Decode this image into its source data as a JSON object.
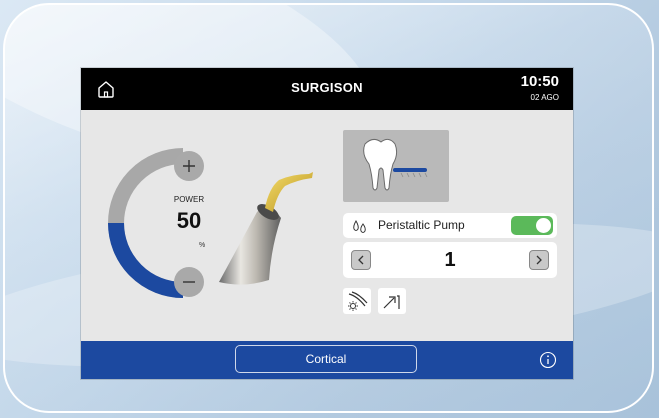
{
  "header": {
    "title": "SURGISON",
    "time": "10:50",
    "date": "02 AGO"
  },
  "power": {
    "label": "POWER",
    "value": "50",
    "unit": "%",
    "level_percent": 50
  },
  "pump": {
    "label": "Peristaltic Pump",
    "enabled": true
  },
  "flow": {
    "value": "1"
  },
  "footer": {
    "program_label": "Cortical"
  },
  "colors": {
    "top_bar": "#000000",
    "bottom_bar": "#1c49a0",
    "arc_active": "#1c49a0",
    "arc_inactive": "#a8a8a8",
    "toggle_on": "#5bb95a",
    "screen_bg": "#e7e7e7",
    "handpiece_tip": "#e2c232"
  },
  "icons": {
    "home": "home-icon",
    "plus": "plus-icon",
    "minus": "minus-icon",
    "drops": "water-drops-icon",
    "prev": "chevron-left-icon",
    "next": "chevron-right-icon",
    "light": "handpiece-light-icon",
    "ramp": "ramp-arrow-icon",
    "info": "info-icon",
    "tooth": "tooth-icon"
  }
}
